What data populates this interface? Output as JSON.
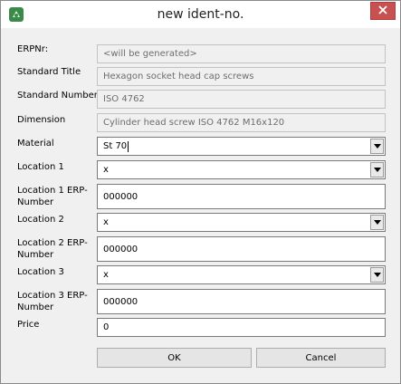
{
  "window": {
    "title": "new ident-no."
  },
  "form": {
    "erpnr": {
      "label": "ERPNr:",
      "value": "<will be generated>"
    },
    "standard_title": {
      "label": "Standard Title",
      "value": "Hexagon socket head cap screws"
    },
    "standard_number": {
      "label": "Standard Number",
      "value": "ISO 4762"
    },
    "dimension": {
      "label": "Dimension",
      "value": "Cylinder head screw ISO 4762 M16x120"
    },
    "material": {
      "label": "Material",
      "value": "St 70"
    },
    "location1": {
      "label": "Location 1",
      "value": "x"
    },
    "location1_erp": {
      "label_line1": "Location 1 ERP-",
      "label_line2": "Number",
      "value": "000000"
    },
    "location2": {
      "label": "Location 2",
      "value": "x"
    },
    "location2_erp": {
      "label_line1": "Location 2 ERP-",
      "label_line2": "Number",
      "value": "000000"
    },
    "location3": {
      "label": "Location 3",
      "value": "x"
    },
    "location3_erp": {
      "label_line1": "Location 3 ERP-",
      "label_line2": "Number",
      "value": "000000"
    },
    "price": {
      "label": "Price",
      "value": "0"
    }
  },
  "buttons": {
    "ok": "OK",
    "cancel": "Cancel"
  },
  "icons": {
    "app": "app-icon",
    "close": "close-icon",
    "dropdown": "chevron-down-icon"
  },
  "colors": {
    "close_button": "#c75050",
    "window_bg": "#f0f0f0"
  }
}
